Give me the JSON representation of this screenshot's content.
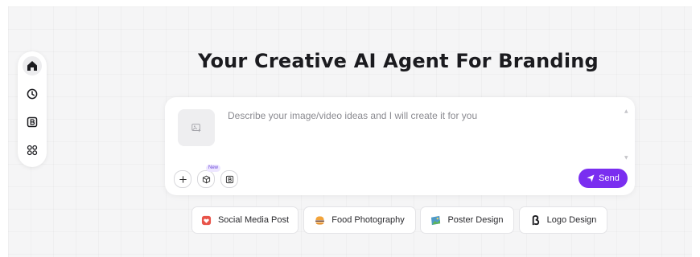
{
  "hero": {
    "title": "Your Creative AI Agent For Branding"
  },
  "sidebar": {
    "items": [
      {
        "icon": "home-icon",
        "active": true
      },
      {
        "icon": "clock-icon",
        "active": false
      },
      {
        "icon": "brand-icon",
        "active": false
      },
      {
        "icon": "apps-grid-icon",
        "active": false
      }
    ]
  },
  "prompt": {
    "placeholder": "Describe your image/video ideas and I will create it for you",
    "tools": {
      "new_badge": "New"
    },
    "send_label": "Send"
  },
  "suggestions": [
    {
      "label": "Social Media Post",
      "icon": "social-media-icon"
    },
    {
      "label": "Food Photography",
      "icon": "burger-icon"
    },
    {
      "label": "Poster Design",
      "icon": "poster-icon"
    },
    {
      "label": "Logo Design",
      "icon": "logo-beta-icon"
    }
  ],
  "colors": {
    "accent": "#7a2ef0",
    "background": "#f5f5f6"
  }
}
